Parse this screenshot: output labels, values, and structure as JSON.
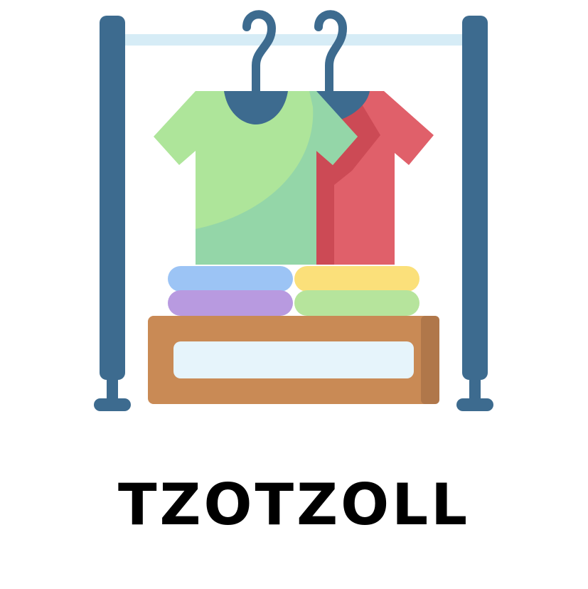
{
  "brand": {
    "name": "TZOTZOLL"
  },
  "icon": {
    "name": "clothing-rack-icon",
    "colors": {
      "pole": "#3d6b8f",
      "rail": "#d6ecf6",
      "hanger": "#3d6b8f",
      "shirt_green": "#aee59a",
      "shirt_green_shade": "#94d6a8",
      "shirt_red": "#e0606a",
      "shirt_red_shade": "#cc4a55",
      "folded_blue": "#9cc4f5",
      "folded_purple": "#b89ae0",
      "folded_yellow": "#fbe07a",
      "folded_lightgreen": "#b6e49c",
      "box": "#c98a55",
      "box_side": "#b0774a",
      "label": "#e6f4fb"
    }
  }
}
